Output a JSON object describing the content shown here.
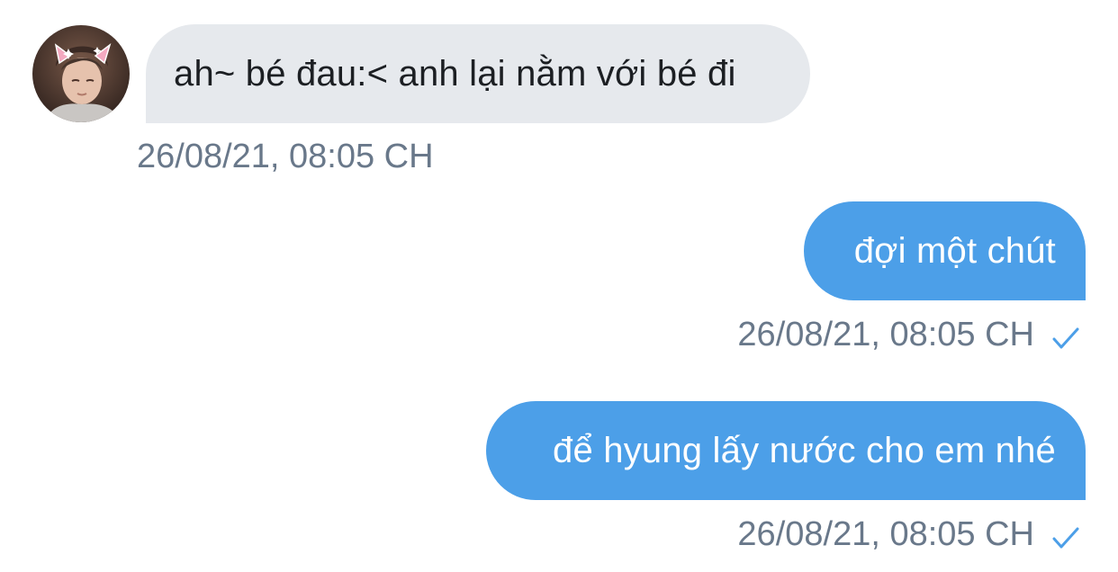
{
  "messages": [
    {
      "direction": "incoming",
      "text": "ah~ bé đau:< anh lại nằm với bé đi",
      "timestamp": "26/08/21, 08:05 CH",
      "sender_avatar": "profile-photo"
    },
    {
      "direction": "outgoing",
      "text": "đợi một chút",
      "timestamp": "26/08/21, 08:05 CH",
      "status_icon": "check-icon"
    },
    {
      "direction": "outgoing",
      "text": "để hyung lấy nước cho em nhé",
      "timestamp": "26/08/21, 08:05 CH",
      "status_icon": "check-icon"
    }
  ],
  "colors": {
    "incoming_bubble": "#e6e9ed",
    "outgoing_bubble": "#4c9fe8",
    "timestamp_text": "#69788a",
    "check": "#4c9fe8"
  }
}
